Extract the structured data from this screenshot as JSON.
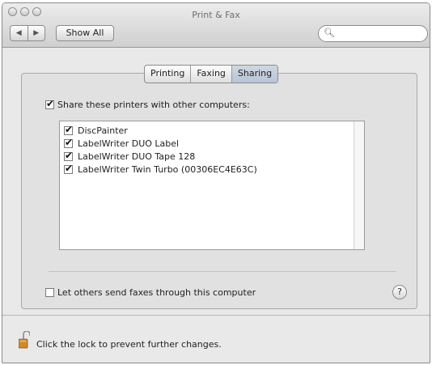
{
  "window": {
    "title": "Print & Fax",
    "traffic_lights": [
      "close",
      "minimize",
      "zoom"
    ]
  },
  "toolbar": {
    "back_label": "◀",
    "forward_label": "▶",
    "show_all_label": "Show All",
    "search": {
      "value": "",
      "placeholder": "",
      "icon": "search-icon"
    }
  },
  "tabs": [
    {
      "label": "Printing",
      "active": false
    },
    {
      "label": "Faxing",
      "active": false
    },
    {
      "label": "Sharing",
      "active": true
    }
  ],
  "sharing": {
    "share_label": "Share these printers with other computers:",
    "share_checked": true,
    "printers": [
      {
        "label": "DiscPainter",
        "checked": true
      },
      {
        "label": "LabelWriter DUO Label",
        "checked": true
      },
      {
        "label": "LabelWriter DUO Tape 128",
        "checked": true
      },
      {
        "label": "LabelWriter Twin Turbo (00306EC4E63C)",
        "checked": true
      }
    ],
    "fax_label": "Let others send faxes through this computer",
    "fax_checked": false,
    "help_label": "?"
  },
  "footer": {
    "lock_icon": "lock-icon",
    "lock_text": "Click the lock to prevent further changes."
  }
}
